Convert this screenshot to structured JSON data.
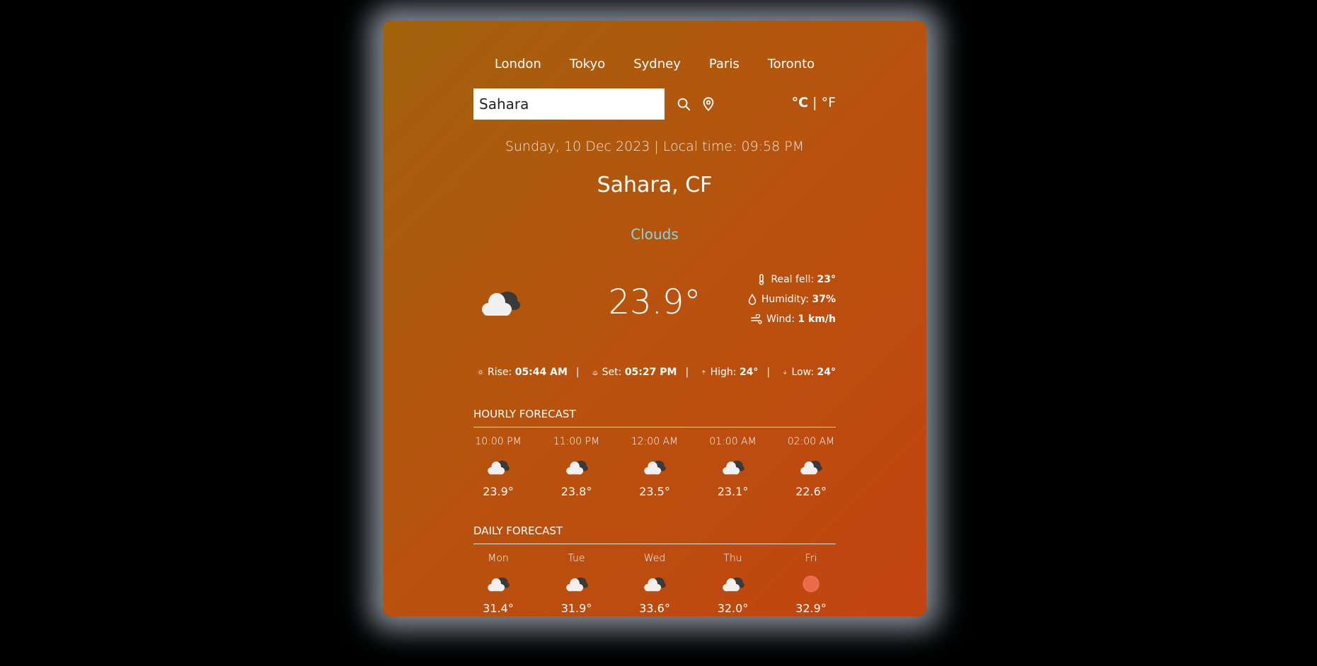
{
  "cities": [
    "London",
    "Tokyo",
    "Sydney",
    "Paris",
    "Toronto"
  ],
  "search": {
    "value": "Sahara"
  },
  "units": {
    "celsius": "°C",
    "separator": "|",
    "fahrenheit": "°F"
  },
  "date_line": "Sunday, 10 Dec 2023 | Local time: 09:58 PM",
  "location": "Sahara, CF",
  "condition": "Clouds",
  "condition_color": "#7ad9ea",
  "temperature": "23.9°",
  "details": {
    "real_feel_label": "Real fell:",
    "real_feel": "23°",
    "humidity_label": "Humidity:",
    "humidity": "37%",
    "wind_label": "Wind:",
    "wind": "1 km/h"
  },
  "sun": {
    "rise_label": "Rise:",
    "rise": "05:44 AM",
    "set_label": "Set:",
    "set": "05:27 PM",
    "high_label": "High:",
    "high": "24°",
    "low_label": "Low:",
    "low": "24°"
  },
  "hourly": {
    "title": "HOURLY FORECAST",
    "items": [
      {
        "label": "10:00 PM",
        "temp": "23.9°",
        "icon": "clouds-icon"
      },
      {
        "label": "11:00 PM",
        "temp": "23.8°",
        "icon": "clouds-icon"
      },
      {
        "label": "12:00 AM",
        "temp": "23.5°",
        "icon": "clouds-icon"
      },
      {
        "label": "01:00 AM",
        "temp": "23.1°",
        "icon": "clouds-icon"
      },
      {
        "label": "02:00 AM",
        "temp": "22.6°",
        "icon": "clouds-icon"
      }
    ]
  },
  "daily": {
    "title": "DAILY FORECAST",
    "items": [
      {
        "label": "Mon",
        "temp": "31.4°",
        "icon": "clouds-icon"
      },
      {
        "label": "Tue",
        "temp": "31.9°",
        "icon": "clouds-icon"
      },
      {
        "label": "Wed",
        "temp": "33.6°",
        "icon": "clouds-icon"
      },
      {
        "label": "Thu",
        "temp": "32.0°",
        "icon": "clouds-icon"
      },
      {
        "label": "Fri",
        "temp": "32.9°",
        "icon": "sun-icon"
      }
    ]
  }
}
